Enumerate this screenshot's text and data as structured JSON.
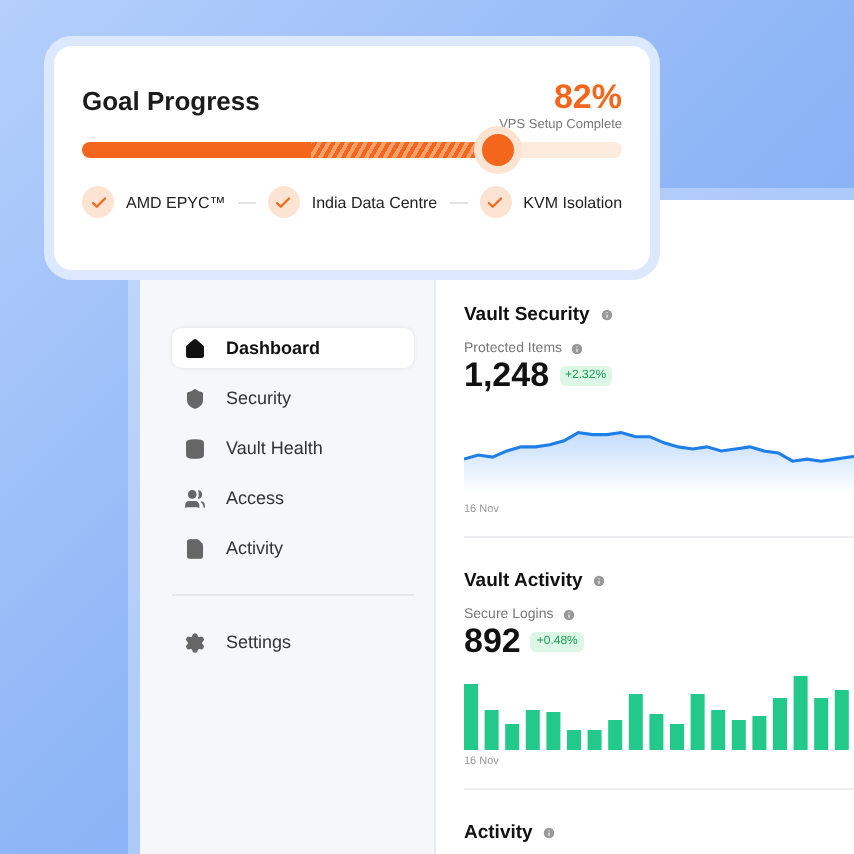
{
  "goal": {
    "title": "Goal Progress",
    "percent": "82%",
    "caption": "VPS Setup Complete",
    "level": 0.77,
    "steps": [
      {
        "label": "AMD EPYC™",
        "checked": true
      },
      {
        "label": "India Data Centre",
        "checked": true
      },
      {
        "label": "KVM Isolation",
        "checked": true
      }
    ]
  },
  "sidebar": {
    "items": [
      {
        "label": "Dashboard",
        "selected": true
      },
      {
        "label": "Security",
        "selected": false
      },
      {
        "label": "Vault Health",
        "selected": false
      },
      {
        "label": "Access",
        "selected": false
      },
      {
        "label": "Activity",
        "selected": false
      }
    ],
    "footer_items": [
      {
        "label": "Settings",
        "selected": false
      }
    ]
  },
  "panels": [
    {
      "title": "Vault Security",
      "kind": "line",
      "metric_label": "Protected Items",
      "value": "1,248",
      "change": "+2.32%",
      "date": "16 Nov"
    },
    {
      "title": "Vault Activity",
      "kind": "bars",
      "metric_label": "Secure Logins",
      "value": "892",
      "change": "+0.48%",
      "date": "16 Nov"
    },
    {
      "title": "Activity",
      "kind": "header"
    }
  ]
}
